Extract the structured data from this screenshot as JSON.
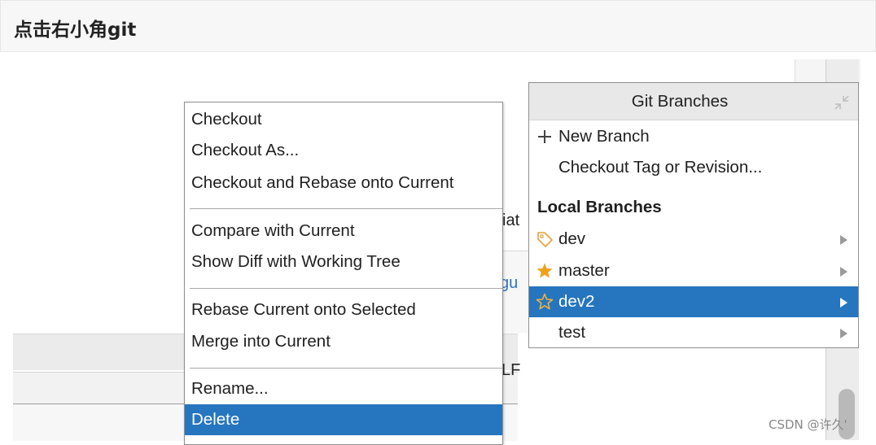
{
  "header": {
    "title": "点击右小角git"
  },
  "background_fragments": {
    "left_text_1": "iat",
    "link_text": "gu",
    "status_text": "LF"
  },
  "context_menu": {
    "items": [
      "Checkout",
      "Checkout As...",
      "Checkout and Rebase onto Current",
      "Compare with Current",
      "Show Diff with Working Tree",
      "Rebase Current onto Selected",
      "Merge into Current",
      "Rename...",
      "Delete"
    ],
    "selected": "Delete"
  },
  "git_branches": {
    "title": "Git Branches",
    "new_branch": "New Branch",
    "checkout_tag": "Checkout Tag or Revision...",
    "local_branches_label": "Local Branches",
    "branches": [
      {
        "name": "dev",
        "icon": "tag-icon"
      },
      {
        "name": "master",
        "icon": "filled-star-icon"
      },
      {
        "name": "dev2",
        "icon": "outline-star-icon"
      },
      {
        "name": "test",
        "icon": ""
      }
    ],
    "selected_branch": "dev2"
  },
  "watermark": "CSDN @许久'",
  "colors": {
    "selection": "#2675bf",
    "star": "#f0a11a",
    "tag": "#e8a23a",
    "link": "#2b74c7"
  }
}
